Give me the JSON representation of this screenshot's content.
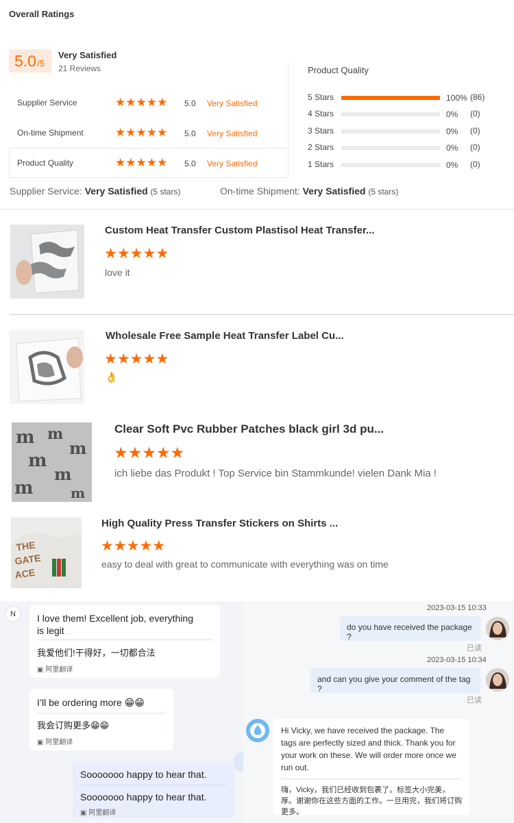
{
  "ratings": {
    "title": "Overall Ratings",
    "score": "5.0",
    "score_max": "/5",
    "summary_label": "Very Satisfied",
    "reviews_count": "21 Reviews",
    "rows": [
      {
        "label": "Supplier Service",
        "rating": 5,
        "score": "5.0",
        "text": "Very Satisfied"
      },
      {
        "label": "On-time Shipment",
        "rating": 5,
        "score": "5.0",
        "text": "Very Satisfied"
      },
      {
        "label": "Product Quality",
        "rating": 5,
        "score": "5.0",
        "text": "Very Satisfied"
      }
    ],
    "distribution": {
      "title": "Product Quality",
      "rows": [
        {
          "label": "5  Stars",
          "fraction": 1.0,
          "pct": "100%",
          "count": "(86)"
        },
        {
          "label": "4  Stars",
          "fraction": 0.0,
          "pct": "0%",
          "count": "(0)"
        },
        {
          "label": "3  Stars",
          "fraction": 0.0,
          "pct": "0%",
          "count": "(0)"
        },
        {
          "label": "2  Stars",
          "fraction": 0.0,
          "pct": "0%",
          "count": "(0)"
        },
        {
          "label": "1  Stars",
          "fraction": 0.0,
          "pct": "0%",
          "count": "(0)"
        }
      ]
    },
    "bottom": {
      "supplier_label": "Supplier Service:",
      "supplier_value": "Very Satisfied",
      "supplier_stars": "(5 stars)",
      "shipment_label": "On-time Shipment:",
      "shipment_value": "Very Satisfied",
      "shipment_stars": "(5 stars)"
    }
  },
  "products": [
    {
      "title": "Custom Heat Transfer Custom Plastisol Heat Transfer...",
      "rating": 5,
      "comment": "love it",
      "icon": "transfer-sheet"
    },
    {
      "title": "Wholesale Free Sample Heat Transfer Label Cu...",
      "rating": 5,
      "comment": "👌",
      "icon": "shirt-transfer"
    },
    {
      "title": "Clear Soft Pvc Rubber Patches black girl 3d pu...",
      "rating": 5,
      "comment": "ich liebe das Produkt ! Top Service bin Stammkunde! vielen Dank Mia !",
      "icon": "pvc-patches"
    },
    {
      "title": "High Quality Press Transfer Stickers on Shirts ...",
      "rating": 5,
      "comment": "easy to deal with great to communicate with everything was on time",
      "icon": "logo-sticker"
    }
  ],
  "chat": {
    "left": {
      "avatar_letter": "N",
      "messages": [
        {
          "text": "I love them! Excellent job, everything is legit",
          "translation": "我爱他们!干得好，一切都合法",
          "translate_label": "阿里翻译"
        },
        {
          "text": "I’ll be ordering more 😁😁",
          "translation": "我会订购更多😁😁",
          "translate_label": "阿里翻译"
        }
      ],
      "self_message": {
        "text": "Sooooooo happy to hear that.",
        "translation": "Sooooooo happy to hear that.",
        "translate_label": "阿里翻译"
      }
    },
    "right": {
      "messages": [
        {
          "time": "2023-03-15 10:33",
          "text": "do you have received the package ?",
          "status": "已读"
        },
        {
          "time": "2023-03-15 10:34",
          "text": "and can you give your comment of the tag ?",
          "status": "已读"
        }
      ],
      "reply": {
        "text": "Hi Vicky, we have received the package. The tags are perfectly sized and thick. Thank you for your work on these. We will order more once we run out.",
        "translation": "嗨，Vicky，我们已经收到包裹了。标签大小完美，厚。谢谢你在这些方面的工作。一旦用完，我们将订购更多。"
      }
    }
  },
  "colors": {
    "accent": "#ff6a00",
    "score_bg": "#fde9dd",
    "bubble_blue": "#e6eef9"
  }
}
